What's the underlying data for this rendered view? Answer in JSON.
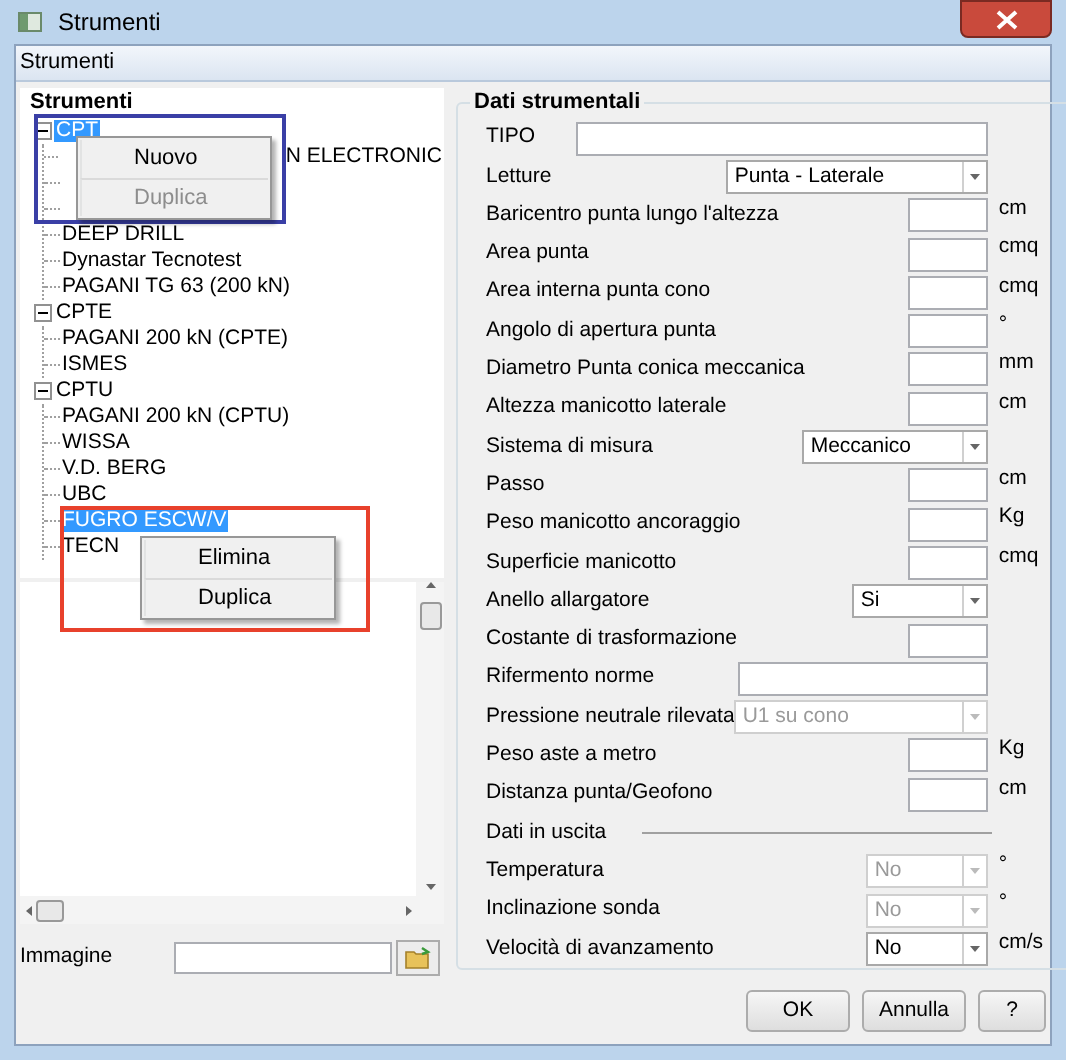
{
  "window": {
    "title": "Strumenti"
  },
  "menu_bar": {
    "label": "Strumenti"
  },
  "tree": {
    "title": "Strumenti",
    "items": [
      {
        "label": "CPT",
        "expanded": true,
        "selected": true,
        "children": [
          {
            "kind": "tail",
            "label": "N ELECTRONIC",
            "selected": false
          },
          {
            "kind": "covered",
            "selected": false
          },
          {
            "kind": "covered",
            "selected": false
          },
          {
            "kind": "item",
            "label": "DEEP DRILL",
            "selected": false
          },
          {
            "kind": "item",
            "label": "Dynastar Tecnotest",
            "selected": false
          },
          {
            "kind": "item",
            "label": "PAGANI TG 63 (200 kN)",
            "selected": false
          }
        ]
      },
      {
        "label": "CPTE",
        "expanded": true,
        "selected": false,
        "children": [
          {
            "kind": "item",
            "label": "PAGANI 200 kN (CPTE)",
            "selected": false
          },
          {
            "kind": "item",
            "label": "ISMES",
            "selected": false
          }
        ]
      },
      {
        "label": "CPTU",
        "expanded": true,
        "selected": false,
        "children": [
          {
            "kind": "item",
            "label": "PAGANI 200 kN (CPTU)",
            "selected": false
          },
          {
            "kind": "item",
            "label": "WISSA",
            "selected": false
          },
          {
            "kind": "item",
            "label": "V.D. BERG",
            "selected": false
          },
          {
            "kind": "item",
            "label": "UBC",
            "selected": false
          },
          {
            "kind": "item",
            "label": "FUGRO ESCW/V",
            "selected": true
          },
          {
            "kind": "item",
            "label": "TECN",
            "selected": false
          }
        ]
      }
    ]
  },
  "context_menus": [
    {
      "color": "#3a3fa6",
      "items": [
        {
          "label": "Nuovo",
          "disabled": false
        },
        {
          "label": "Duplica",
          "disabled": true
        }
      ]
    },
    {
      "color": "#e8412c",
      "items": [
        {
          "label": "Elimina",
          "disabled": false
        },
        {
          "label": "Duplica",
          "disabled": false
        }
      ]
    }
  ],
  "image": {
    "label": "Immagine"
  },
  "form": {
    "title": "Dati strumentali",
    "rows": [
      {
        "kind": "text",
        "label": "TIPO"
      },
      {
        "kind": "combo",
        "label": "Letture",
        "value": "Punta - Laterale",
        "disabled": false
      },
      {
        "kind": "number",
        "label": "Baricentro punta lungo l'altezza",
        "unit": "cm"
      },
      {
        "kind": "number",
        "label": "Area punta",
        "unit": "cmq"
      },
      {
        "kind": "number",
        "label": "Area interna punta cono",
        "unit": "cmq"
      },
      {
        "kind": "number",
        "label": "Angolo di apertura punta",
        "unit": "°"
      },
      {
        "kind": "number",
        "label": "Diametro Punta conica meccanica",
        "unit": "mm"
      },
      {
        "kind": "number",
        "label": "Altezza manicotto laterale",
        "unit": "cm"
      },
      {
        "kind": "combo",
        "label": "Sistema di misura",
        "value": "Meccanico",
        "disabled": false
      },
      {
        "kind": "number",
        "label": "Passo",
        "unit": "cm"
      },
      {
        "kind": "number",
        "label": "Peso manicotto ancoraggio",
        "unit": "Kg"
      },
      {
        "kind": "number",
        "label": "Superficie manicotto",
        "unit": "cmq"
      },
      {
        "kind": "combo",
        "label": "Anello allargatore",
        "value": "Si",
        "disabled": false
      },
      {
        "kind": "number",
        "label": "Costante di trasformazione"
      },
      {
        "kind": "text",
        "label": "Rifermento norme"
      },
      {
        "kind": "combo",
        "label": "Pressione neutrale rilevata",
        "value": "U1 su cono",
        "disabled": true
      },
      {
        "kind": "number",
        "label": "Peso aste a metro",
        "unit": "Kg"
      },
      {
        "kind": "number",
        "label": "Distanza punta/Geofono",
        "unit": "cm"
      },
      {
        "kind": "section",
        "label": "Dati in uscita"
      },
      {
        "kind": "combo",
        "label": "Temperatura",
        "value": "No",
        "disabled": true,
        "unit": "°"
      },
      {
        "kind": "combo",
        "label": "Inclinazione sonda",
        "value": "No",
        "disabled": true,
        "unit": "°"
      },
      {
        "kind": "combo",
        "label": "Velocità di avanzamento",
        "value": "No",
        "disabled": false,
        "unit": "cm/s"
      }
    ]
  },
  "buttons": [
    "OK",
    "Annulla",
    "?"
  ]
}
